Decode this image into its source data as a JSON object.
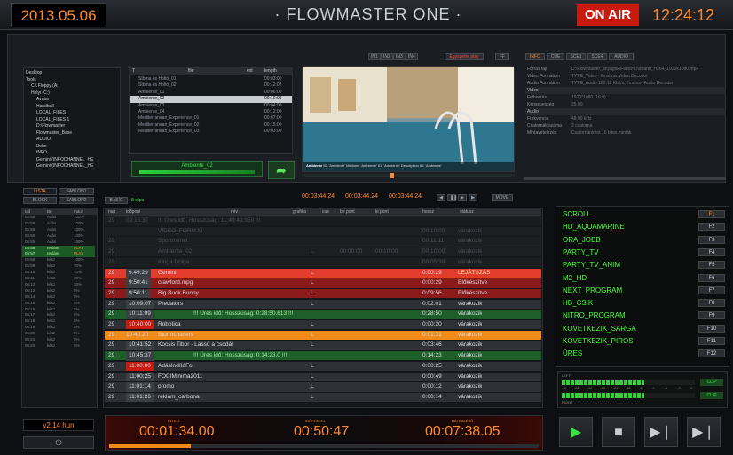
{
  "topbar": {
    "date": "2013.05.06",
    "title": "· FLOWMASTER ONE ·",
    "onair": "ON AIR",
    "clock": "12:24:12"
  },
  "preview_buttons": [
    "IN1",
    "IN2",
    "IN3",
    "IN4",
    "Egyszerre play",
    "FF"
  ],
  "info_tabs": [
    "INFO",
    "CUE",
    "SCE1",
    "SCE4",
    "AUDIO"
  ],
  "tree": [
    "Desktop",
    "Tools",
    "C:\\ Floppy (A:)",
    "Helyi (C:)",
    "Avatar",
    "Handball",
    "LOCAL_FILES",
    "LOCAL_FILES 1",
    "D:\\Flowmaster",
    "Flowmaster_Base",
    "AUDIO",
    "Bebe",
    "INFO",
    "Gemini (INFOCHANNEL_HE",
    "Gemini (INFOCHANNEL_HE"
  ],
  "filelist": {
    "headers": [
      "T",
      "file",
      "ext",
      "length"
    ],
    "rows": [
      [
        "",
        "Stbma és Holtó_01",
        "",
        "00:03:00"
      ],
      [
        "",
        "Stbma és Holtó_02",
        "",
        "00:12:02"
      ],
      [
        "",
        "Ambiente_01",
        "",
        "00:06:00"
      ],
      [
        "",
        "Ambiente_02",
        "",
        "00:10:00"
      ],
      [
        "",
        "Ambiente_03",
        "",
        "00:04:00"
      ],
      [
        "",
        "Ambiente_04",
        "",
        "00:12:00"
      ],
      [
        "",
        "Mediterranean_Experience_01",
        "",
        "00:07:00"
      ],
      [
        "",
        "Mediterranean_Experience_02",
        "",
        "00:15:00"
      ],
      [
        "",
        "Mediterranean_Experience_03",
        "",
        "00:03:00"
      ]
    ],
    "selected_index": 3,
    "selected_name": "Ambiente_02"
  },
  "preview": {
    "caption_title": "Ambiente",
    "caption": "ID: 'Ambiente' Medium: 'Ambiente' ID: 'Ambiente' Description ID: 'Ambiente'",
    "tc_in": "00:03:44.24",
    "tc_dur": "00:03:44.24",
    "tc_out": "00:03:44.24",
    "move": "MOVE"
  },
  "info": [
    [
      "Forrás fájl",
      "D:\\FlowMaster_anyagok\\Files\\HD\\strand_H264_1920x1080.mp4"
    ],
    [
      "Video Formátum",
      "TYPE_Video - ffmshow Video Decoder"
    ],
    [
      "Audio Formátum",
      "TYPE_Audio 160.12 Kbit/s, ffmshow Audio Decoder"
    ],
    [
      "Video",
      ""
    ],
    [
      "Felbontás",
      "1920*1080 (16:9)"
    ],
    [
      "Képsebesség",
      "25.00"
    ],
    [
      "Audio",
      ""
    ],
    [
      "Frekvencia",
      "48.00 kHz"
    ],
    [
      "Csatornák száma",
      "2 csatorna"
    ],
    [
      "Mintavételezés",
      "Csatornánként 16 bites minták"
    ]
  ],
  "left_tabs": [
    "LISTA",
    "SABLON1",
    "BLOKK",
    "SABLON2"
  ],
  "log": {
    "headers": [
      "Idő",
      "Be",
      "Indult"
    ],
    "rows": [
      [
        "05:55",
        "Adás",
        "100%"
      ],
      [
        "05:55",
        "Adás",
        "100%"
      ],
      [
        "05:55",
        "Adás",
        "100%"
      ],
      [
        "05:55",
        "Adás",
        "100%"
      ],
      [
        "05:55",
        "Adás",
        "100%"
      ],
      [
        "05:56",
        "reklám",
        "PLAY"
      ],
      [
        "05:57",
        "reklám",
        "PLAY"
      ],
      [
        "05:58",
        "kész",
        "100%"
      ],
      [
        "05:59",
        "kész",
        "70%"
      ],
      [
        "06:10",
        "kész",
        "70%"
      ],
      [
        "06:11",
        "kész",
        "30%"
      ],
      [
        "06:12",
        "kész",
        "30%"
      ],
      [
        "06:13",
        "kész",
        "5%"
      ],
      [
        "06:14",
        "kész",
        "5%"
      ],
      [
        "06:15",
        "kész",
        "5%"
      ],
      [
        "06:16",
        "kész",
        "5%"
      ],
      [
        "06:17",
        "kész",
        "5%"
      ],
      [
        "06:18",
        "kész",
        "5%"
      ],
      [
        "06:19",
        "kész",
        "5%"
      ],
      [
        "06:20",
        "kész",
        "5%"
      ],
      [
        "06:21",
        "kész",
        "5%"
      ],
      [
        "06:22",
        "kész",
        "5%"
      ]
    ],
    "highlight": [
      5,
      6
    ]
  },
  "playlist_toolbar": {
    "mode": "BASIC",
    "count": "8 clips"
  },
  "playlist": {
    "headers": [
      "nap",
      "időpont",
      "név",
      "grafika",
      "cue",
      "be pont",
      "ki pont",
      "hossz",
      "státusz"
    ],
    "rows": [
      [
        "29",
        "09:15:37",
        "!!! Üres idő: Hosszúság: 11:49:49.950 !!!",
        "",
        "",
        "",
        "",
        "",
        "",
        "gap-dim"
      ],
      [
        "",
        "",
        "VIDEO_FORM.M",
        "",
        "",
        "",
        "",
        "00:10:00",
        "várakozik",
        "dim"
      ],
      [
        "29",
        "",
        "Sportmenet",
        "",
        "",
        "",
        "",
        "00:11:11",
        "várakozik",
        "dim"
      ],
      [
        "29",
        "",
        "Ambiente_02",
        "L",
        "",
        "00:00:00",
        "00:10:00",
        "00:10:00",
        "várakozik",
        "dim"
      ],
      [
        "29",
        "",
        "Kinga Dolga",
        "",
        "",
        "",
        "",
        "00:05:30",
        "várakozik",
        "dim"
      ],
      [
        "29",
        "9:49:29",
        "Gemini",
        "L",
        "",
        "",
        "",
        "0:00:29",
        "LEJÁTSZÁS",
        "red"
      ],
      [
        "29",
        "9:50:41",
        "crawford.mpg",
        "L",
        "",
        "",
        "",
        "0:00:29",
        "Előkészítve",
        "darkred"
      ],
      [
        "29",
        "9:50:11",
        "Big Buck Bunny",
        "L",
        "",
        "",
        "",
        "0:09:56",
        "Előkészítve",
        "darkred"
      ],
      [
        "29",
        "10:09:07",
        "Predators",
        "L",
        "",
        "",
        "",
        "0:02:01",
        "várakozik",
        "grey"
      ],
      [
        "29",
        "10:11:09",
        "!!! Üres idő: Hosszúság: 0:28:50.613 !!!",
        "",
        "",
        "",
        "",
        "0:28:50",
        "várakozik",
        "green"
      ],
      [
        "29",
        "10:40:00",
        "Robotica",
        "L",
        "",
        "",
        "",
        "0:00:20",
        "várakozik",
        "grey"
      ],
      [
        "29",
        "10:40:20",
        "Stormchasers",
        "L",
        "",
        "",
        "",
        "0:01:31",
        "várakozik",
        "orange"
      ],
      [
        "29",
        "10:41:52",
        "Kocsis Tibor - Lassú a csodát",
        "L",
        "",
        "",
        "",
        "0:03:46",
        "várakozik",
        "grey"
      ],
      [
        "29",
        "10:45:37",
        "!!! Üres idő: Hosszúság: 0:14:23.0 !!!",
        "",
        "",
        "",
        "",
        "0:14:23",
        "várakozik",
        "green"
      ],
      [
        "29",
        "11:00:00",
        "AdásIndítóFo",
        "L",
        "",
        "",
        "",
        "0:00:25",
        "várakozik",
        "grey"
      ],
      [
        "29",
        "11:00:25",
        "FOCIMinima2011",
        "L",
        "",
        "",
        "",
        "0:00:49",
        "várakozik",
        "grey"
      ],
      [
        "29",
        "11:01:14",
        "promo",
        "L",
        "",
        "",
        "",
        "0:00:12",
        "várakozik",
        "grey"
      ],
      [
        "29",
        "11:01:26",
        "reklám_carbona",
        "L",
        "",
        "",
        "",
        "0:00:14",
        "várakozik",
        "grey"
      ]
    ]
  },
  "fkeys": [
    [
      "SCROLL",
      "F1"
    ],
    [
      "HD_AQUAMARINE",
      "F2"
    ],
    [
      "ORA_JOBB",
      "F3"
    ],
    [
      "PARTY_TV",
      "F4"
    ],
    [
      "PARTY_TV_ANIM",
      "F5"
    ],
    [
      "M2_HD",
      "F6"
    ],
    [
      "NEXT_PROGRAM",
      "F7"
    ],
    [
      "HB_CSIK",
      "F8"
    ],
    [
      "NITRO_PROGRAM",
      "F9"
    ],
    [
      "KOVETKEZIK_SARGA",
      "F10"
    ],
    [
      "KOVETKEZIK_PIROS",
      "F11"
    ],
    [
      "ÜRES",
      "F12"
    ]
  ],
  "audio_meter": {
    "label_top": "LEFT",
    "label_bottom": "RIGHT",
    "scale": [
      "-48",
      "-42",
      "-36",
      "-30",
      "-24",
      "-18",
      "-12",
      "-9",
      "-6",
      "-3",
      "0"
    ],
    "clip": "CLIP",
    "level_left": 0.62,
    "level_right": 0.62
  },
  "bottom": {
    "version": "v2,14 hun",
    "elapsed_label": "ELTELT",
    "elapsed": "00:01:34.00",
    "time_label": "IDŐPONTIG",
    "time": "00:50:47",
    "remain_label": "HÁTRALÉVŐ",
    "remain": "00:07:38.05",
    "progress": 0.19
  },
  "colors": {
    "accent": "#ff8a2a",
    "onair": "#c81a0e",
    "playing": "#e13c2d",
    "prepared": "#8b1a1a",
    "waiting_green": "#1d5e2a",
    "orange_row": "#f08a18",
    "fkey_text": "#4cff3a"
  }
}
